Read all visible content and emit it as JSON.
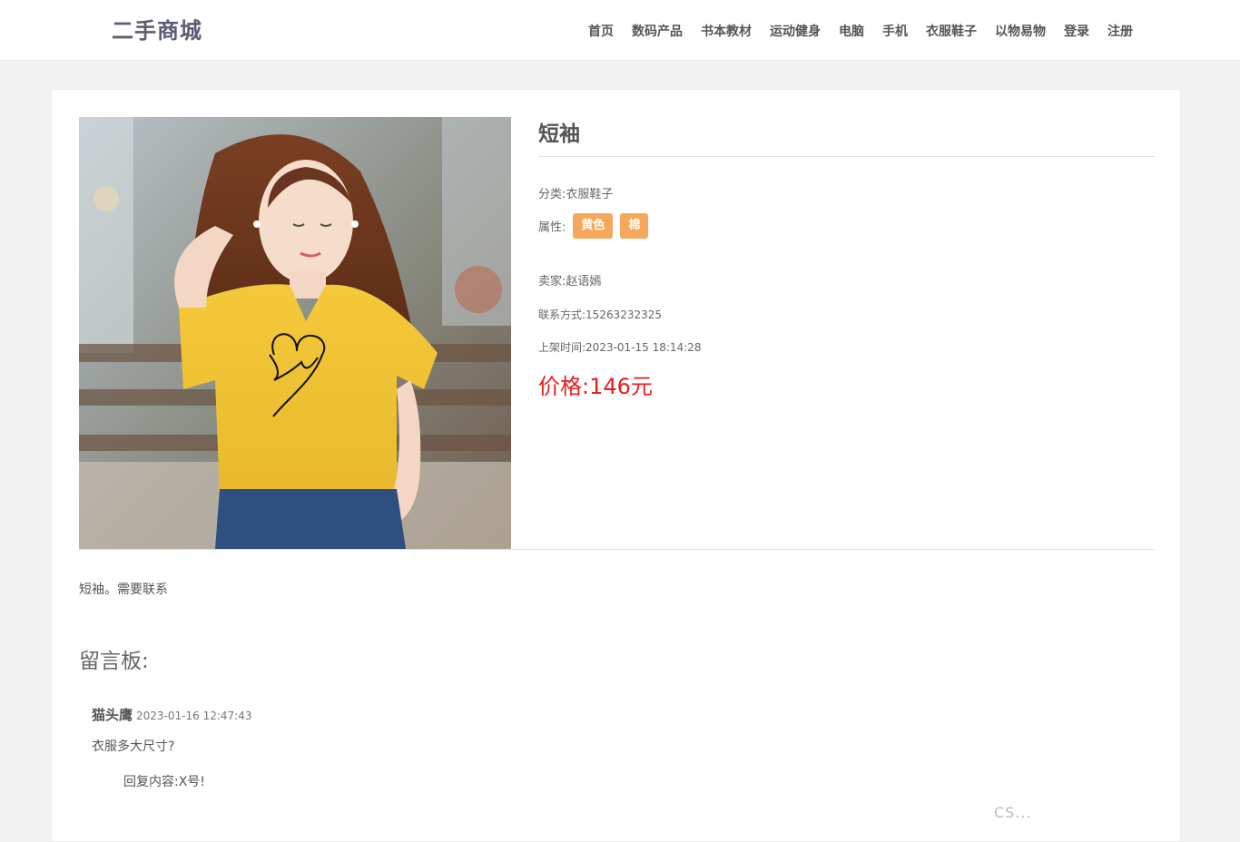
{
  "header": {
    "brand": "二手商城",
    "nav": [
      "首页",
      "数码产品",
      "书本教材",
      "运动健身",
      "电脑",
      "手机",
      "衣服鞋子",
      "以物易物",
      "登录",
      "注册"
    ]
  },
  "product": {
    "image_icon": "product-photo-yellow-tshirt",
    "title": "短袖",
    "category_label": "分类:",
    "category": "衣服鞋子",
    "attr_label": "属性:",
    "attrs": [
      "黄色",
      "棉"
    ],
    "seller_label": "卖家:",
    "seller": "赵语嫣",
    "contact_label": "联系方式:",
    "contact": "15263232325",
    "time_label": "上架时间:",
    "time": "2023-01-15 18:14:28",
    "price_label": "价格:",
    "price": "146元",
    "description": "短袖。需要联系"
  },
  "board": {
    "title": "留言板:",
    "comments": [
      {
        "author": "猫头鹰",
        "time": "2023-01-16 12:47:43",
        "text": "衣服多大尺寸?",
        "reply_label": "回复内容:",
        "reply": "X号!"
      }
    ]
  },
  "watermark": "CS...",
  "colors": {
    "tag": "#f5a85c",
    "price": "#e81c1c",
    "brand": "#5a5d70"
  }
}
